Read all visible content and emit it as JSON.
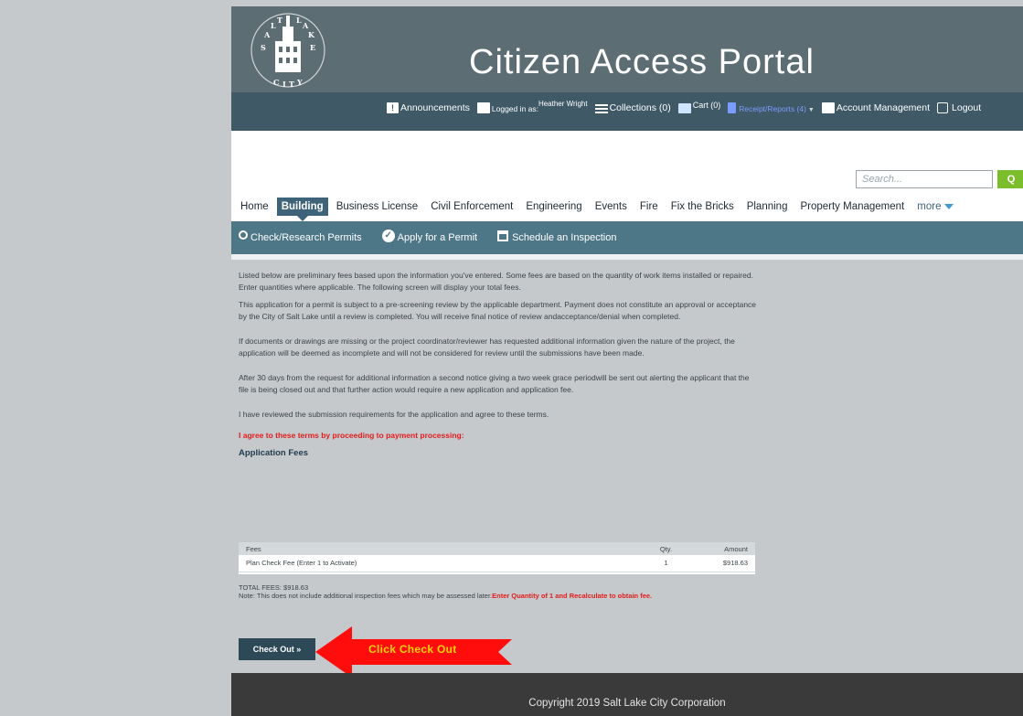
{
  "header": {
    "title": "Citizen Access Portal",
    "seal_text": "SALT LAKE CITY"
  },
  "topnav": {
    "announcements": "Announcements",
    "logged_in_prefix": "Logged in as:",
    "user_name": "Heather Wright",
    "collections": "Collections (0)",
    "cart": "Cart (0)",
    "receipts": "Receipt/Reports (4)",
    "account": "Account Management",
    "logout": "Logout"
  },
  "search": {
    "placeholder": "Search...",
    "button_icon": "search-icon"
  },
  "tabs": [
    "Home",
    "Building",
    "Business License",
    "Civil Enforcement",
    "Engineering",
    "Events",
    "Fire",
    "Fix the Bricks",
    "Planning",
    "Property Management",
    "more"
  ],
  "active_tab": "Building",
  "subnav": {
    "research": "Check/Research Permits",
    "apply": "Apply for a Permit",
    "schedule": "Schedule an Inspection"
  },
  "content": {
    "p1": "Listed below are preliminary fees based upon the information you've entered. Some fees are based on the quantity of work items installed or repaired. Enter quantities where applicable. The following screen will display your total fees.",
    "p2": "This application for a permit is subject to a pre-screening review by the applicable department. Payment does not constitute an approval or acceptance by the City of Salt Lake until a review is completed. You will receive final notice of review andacceptance/denial when completed.",
    "p3": "If documents or drawings are missing or the project coordinator/reviewer has requested additional information given the nature of the project, the application will be deemed as incomplete and will not be considered for review until the submissions have been made.",
    "p4": "After 30 days from the request for additional information a second notice giving a two week grace periodwill be sent out alerting the applicant that the file is being closed out and that further action would require a new application and application fee.",
    "p5": "I have reviewed the submission requirements for the application and agree to these terms.",
    "agree": "I agree to these terms by proceeding to payment processing:",
    "app_fees": "Application Fees"
  },
  "fees_table": {
    "headers": [
      "Fees",
      "Qty.",
      "Amount"
    ],
    "rows": [
      {
        "fee": "Plan Check Fee (Enter 1 to Activate)",
        "qty": "1",
        "amount": "$918.63"
      }
    ]
  },
  "totals": {
    "total": "TOTAL FEES: $918.63",
    "note": "Note: This does not include additional inspection fees which may be assessed later.",
    "note_red": "Enter Quantity of 1 and Recalculate to obtain fee."
  },
  "checkout_label": "Check Out »",
  "arrow_label": "Click Check Out",
  "footer": "Copyright 2019 Salt Lake City Corporation",
  "colors": {
    "header": "#5d6d74",
    "band": "#3f5966",
    "subnav": "#4d7687",
    "accent_red": "#e41b1b",
    "checkout": "#2d4857",
    "footer": "#3a3a3a"
  }
}
